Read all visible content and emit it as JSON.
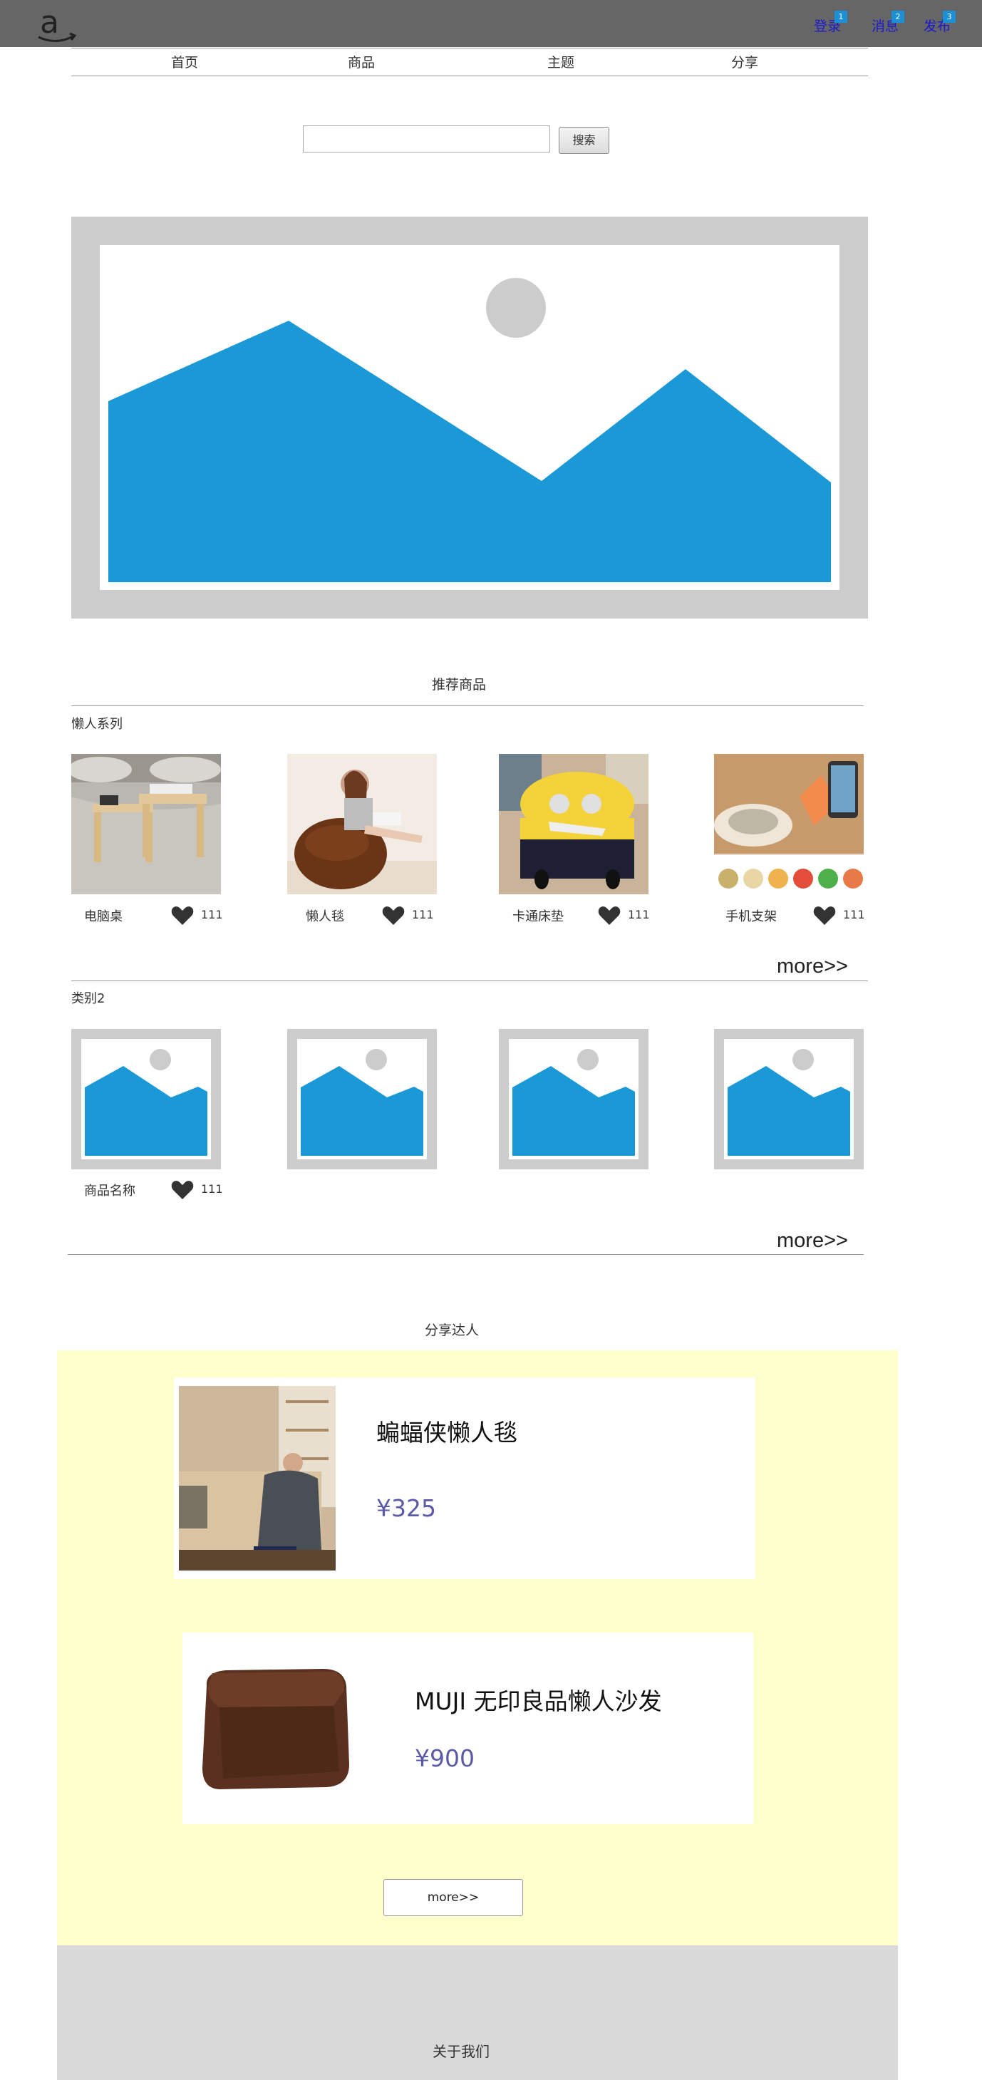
{
  "header": {
    "logo_icon": "amazon-logo-icon",
    "links": [
      {
        "label": "登录",
        "badge": "1"
      },
      {
        "label": "消息",
        "badge": "2"
      },
      {
        "label": "发布",
        "badge": "3"
      }
    ]
  },
  "nav": {
    "items": [
      "首页",
      "商品",
      "主题",
      "分享"
    ]
  },
  "search": {
    "value": "",
    "placeholder": "",
    "button_label": "搜索"
  },
  "banner": {
    "icon": "image-placeholder-icon"
  },
  "recommend": {
    "title": "推荐商品",
    "categories": [
      {
        "name": "懒人系列",
        "items": [
          {
            "name": "电脑桌",
            "likes": "111"
          },
          {
            "name": "懒人毯",
            "likes": "111"
          },
          {
            "name": "卡通床垫",
            "likes": "111"
          },
          {
            "name": "手机支架",
            "likes": "111"
          }
        ],
        "more": "more>>"
      },
      {
        "name": "类别2",
        "items": [
          {
            "name": "商品名称",
            "likes": "111"
          }
        ],
        "more": "more>>"
      }
    ]
  },
  "share": {
    "title": "分享达人",
    "cards": [
      {
        "title": "蝙蝠侠懒人毯",
        "price": "¥325"
      },
      {
        "title": "MUJI 无印良品懒人沙发",
        "price": "¥900"
      }
    ],
    "more": "more>>"
  },
  "footer": {
    "about": "关于我们"
  },
  "colors": {
    "topbar": "#666666",
    "accent_blue": "#1b99d6",
    "share_bg": "#ffffcc",
    "price": "#5a5aa6",
    "link": "#1a1acb"
  }
}
